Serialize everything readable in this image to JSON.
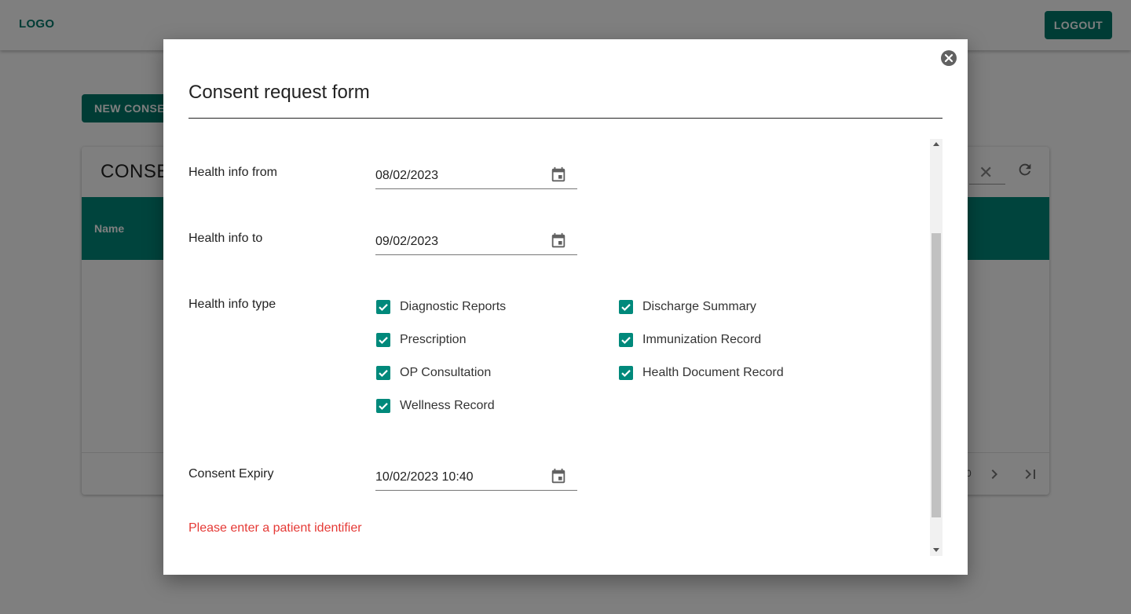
{
  "header": {
    "logo": "LOGO",
    "logout_label": "LOGOUT"
  },
  "background": {
    "new_consent_label": "NEW CONSENT",
    "card_title": "CONSENTS",
    "table_header_name": "Name",
    "pager_text": "0",
    "icons": {
      "clear": "close-icon",
      "refresh": "refresh-icon",
      "next": "chevron-right-icon",
      "last": "last-page-icon"
    }
  },
  "modal": {
    "title": "Consent request form",
    "health_info_from": {
      "label": "Health info from",
      "value": "08/02/2023"
    },
    "health_info_to": {
      "label": "Health info to",
      "value": "09/02/2023"
    },
    "health_info_type": {
      "label": "Health info type",
      "options": [
        {
          "label": "Diagnostic Reports",
          "checked": true
        },
        {
          "label": "Discharge Summary",
          "checked": true
        },
        {
          "label": "Prescription",
          "checked": true
        },
        {
          "label": "Immunization Record",
          "checked": true
        },
        {
          "label": "OP Consultation",
          "checked": true
        },
        {
          "label": "Health Document Record",
          "checked": true
        },
        {
          "label": "Wellness Record",
          "checked": true
        }
      ]
    },
    "consent_expiry": {
      "label": "Consent Expiry",
      "value": "10/02/2023 10:40"
    },
    "error_message": "Please enter a patient identifier"
  },
  "colors": {
    "primary": "#00796b",
    "table_header": "#00897b",
    "checkbox": "#00897b",
    "error": "#e53935"
  }
}
